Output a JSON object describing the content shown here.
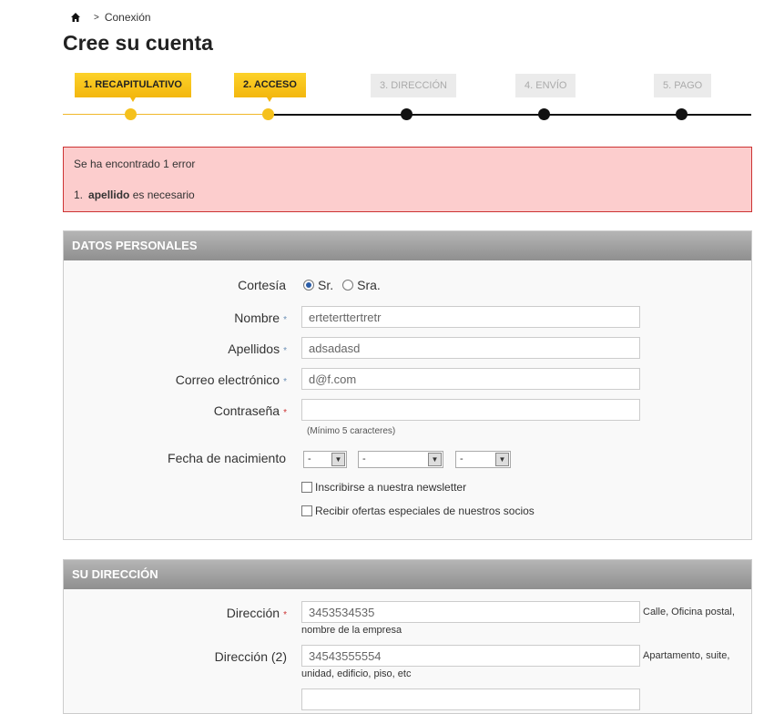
{
  "breadcrumb": {
    "home_icon": "home-icon",
    "separator": ">",
    "current": "Conexión"
  },
  "page_title": "Cree su cuenta",
  "steps": [
    {
      "label": "1. RECAPITULATIVO",
      "state": "done"
    },
    {
      "label": "2. ACCESO",
      "state": "current"
    },
    {
      "label": "3. DIRECCIÓN",
      "state": "todo"
    },
    {
      "label": "4. ENVÍO",
      "state": "todo"
    },
    {
      "label": "5. PAGO",
      "state": "todo"
    }
  ],
  "error": {
    "title": "Se ha encontrado 1 error",
    "items": [
      {
        "num": "1.",
        "field": "apellido",
        "msg": " es necesario"
      }
    ]
  },
  "personal": {
    "header": "DATOS PERSONALES",
    "courtesy_label": "Cortesía",
    "courtesy_options": [
      "Sr.",
      "Sra."
    ],
    "courtesy_selected": "Sr.",
    "required_mark": "*",
    "first_name": {
      "label": "Nombre",
      "value": "erteterttertretr"
    },
    "last_name": {
      "label": "Apellidos",
      "value": "adsadasd"
    },
    "email": {
      "label": "Correo electrónico",
      "value": "d@f.com"
    },
    "password": {
      "label": "Contraseña",
      "value": "",
      "hint": "(Mínimo 5 caracteres)"
    },
    "birth": {
      "label": "Fecha de nacimiento",
      "day": "-",
      "month": "-",
      "year": "-"
    },
    "newsletter": "Inscribirse a nuestra newsletter",
    "offers": "Recibir ofertas especiales de nuestros socios"
  },
  "address": {
    "header": "SU DIRECCIÓN",
    "address1": {
      "label": "Dirección",
      "value": "3453534535",
      "hint1": "Calle, Oficina postal,",
      "hint2": "nombre de la empresa"
    },
    "address2": {
      "label": "Dirección (2)",
      "value": "34543555554",
      "hint1": "Apartamento, suite,",
      "hint2": "unidad, edificio, piso, etc"
    }
  }
}
